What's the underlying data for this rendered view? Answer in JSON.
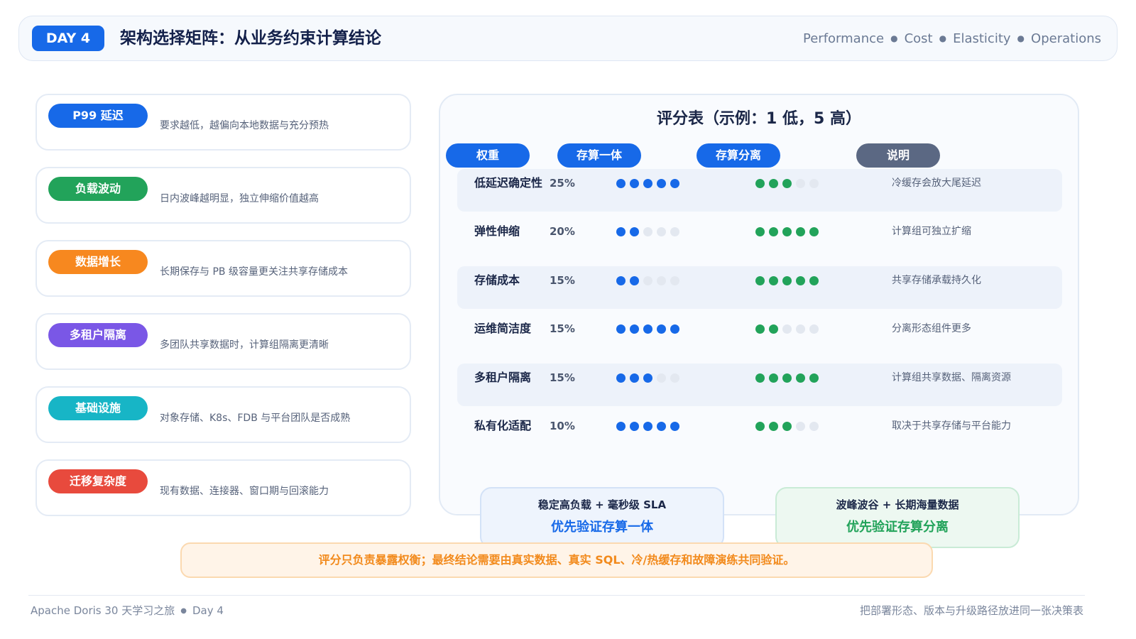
{
  "header": {
    "badge": "DAY 4",
    "title": "架构选择矩阵：从业务约束计算结论",
    "tags": [
      "Performance",
      "Cost",
      "Elasticity",
      "Operations"
    ]
  },
  "factors": [
    {
      "label": "P99 延迟",
      "desc": "要求越低，越偏向本地数据与充分预热",
      "color": "#1769e8"
    },
    {
      "label": "负载波动",
      "desc": "日内波峰越明显，独立伸缩价值越高",
      "color": "#22a35a"
    },
    {
      "label": "数据增长",
      "desc": "长期保存与 PB 级容量更关注共享存储成本",
      "color": "#f7881f"
    },
    {
      "label": "多租户隔离",
      "desc": "多团队共享数据时，计算组隔离更清晰",
      "color": "#7a57e6"
    },
    {
      "label": "基础设施",
      "desc": "对象存储、K8s、FDB 与平台团队是否成熟",
      "color": "#17b5c6"
    },
    {
      "label": "迁移复杂度",
      "desc": "现有数据、连接器、窗口期与回滚能力",
      "color": "#e84a3d"
    }
  ],
  "scores": {
    "title": "评分表（示例：1 低，5 高）",
    "columns": {
      "weight": {
        "label": "权重",
        "color": "#1769e8"
      },
      "integrated": {
        "label": "存算一体",
        "color": "#1769e8"
      },
      "separated": {
        "label": "存算分离",
        "color": "#1769e8"
      },
      "note": {
        "label": "说明",
        "color": "#5b6883"
      }
    },
    "max": 5,
    "integrated_color": "#1769e8",
    "separated_color": "#22a35a",
    "empty_color": "#e3e8f0",
    "rows": [
      {
        "name": "低延迟确定性",
        "weight": "25%",
        "integrated": 5,
        "separated": 3,
        "note": "冷缓存会放大尾延迟"
      },
      {
        "name": "弹性伸缩",
        "weight": "20%",
        "integrated": 2,
        "separated": 5,
        "note": "计算组可独立扩缩"
      },
      {
        "name": "存储成本",
        "weight": "15%",
        "integrated": 2,
        "separated": 5,
        "note": "共享存储承载持久化"
      },
      {
        "name": "运维简洁度",
        "weight": "15%",
        "integrated": 5,
        "separated": 2,
        "note": "分离形态组件更多"
      },
      {
        "name": "多租户隔离",
        "weight": "15%",
        "integrated": 3,
        "separated": 5,
        "note": "计算组共享数据、隔离资源"
      },
      {
        "name": "私有化适配",
        "weight": "10%",
        "integrated": 5,
        "separated": 3,
        "note": "取决于共享存储与平台能力"
      }
    ]
  },
  "recommendations": [
    {
      "condition": "稳定高负载 + 毫秒级 SLA",
      "action": "优先验证存算一体"
    },
    {
      "condition": "波峰波谷 + 长期海量数据",
      "action": "优先验证存算分离"
    }
  ],
  "warning": "评分只负责暴露权衡；最终结论需要由真实数据、真实 SQL、冷/热缓存和故障演练共同验证。",
  "footer": {
    "series": "Apache Doris 30 天学习之旅",
    "day": "Day 4",
    "right": "把部署形态、版本与升级路径放进同一张决策表"
  }
}
